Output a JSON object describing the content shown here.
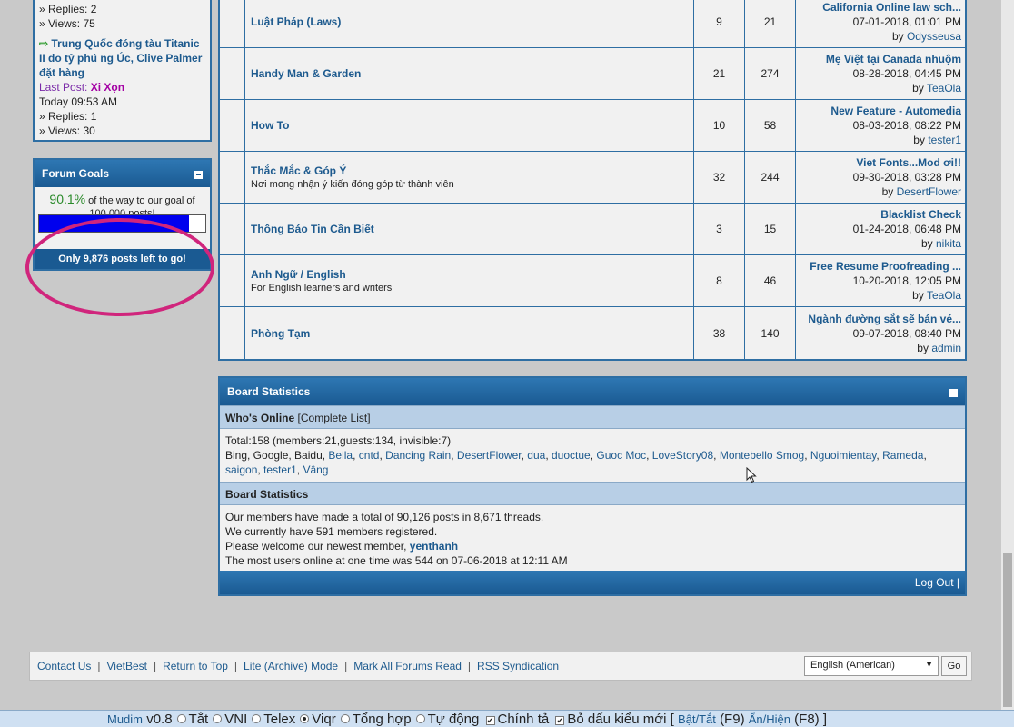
{
  "sidebar": {
    "recent": {
      "prev_replies": "» Replies: 2",
      "prev_views": "» Views: 75",
      "thread_title": "Trung Quốc đóng tàu Titanic II do tỷ phú ng Úc, Clive Palmer đặt hàng",
      "last_post_label": "Last Post:",
      "last_post_user": "Xi Xọn",
      "last_post_time": "Today 09:53 AM",
      "replies": "» Replies: 1",
      "views": "» Views: 30"
    },
    "goals": {
      "title": "Forum Goals",
      "percent_text": "90.1%",
      "goal_text": "of the way to our goal of 100,000 posts!",
      "progress": 0.901,
      "remaining": "Only 9,876 posts left to go!"
    }
  },
  "forums": [
    {
      "name": "Luật Pháp (Laws)",
      "desc": "",
      "threads": "9",
      "posts": "21",
      "last_title": "California Online law sch...",
      "last_date": "07-01-2018,",
      "last_time": "01:01 PM",
      "last_user": "Odysseusa"
    },
    {
      "name": "Handy Man & Garden",
      "desc": "",
      "threads": "21",
      "posts": "274",
      "last_title": "Mẹ Việt tại Canada nhuộm",
      "last_date": "08-28-2018,",
      "last_time": "04:45 PM",
      "last_user": "TeaOla"
    },
    {
      "name": "How To",
      "desc": "",
      "threads": "10",
      "posts": "58",
      "last_title": "New Feature - Automedia",
      "last_date": "08-03-2018,",
      "last_time": "08:22 PM",
      "last_user": "tester1"
    },
    {
      "name": "Thắc Mắc & Góp Ý",
      "desc": "Nơi mong nhận ý kiến đóng góp từ thành viên",
      "threads": "32",
      "posts": "244",
      "last_title": "Viet Fonts...Mod ơi!!",
      "last_date": "09-30-2018,",
      "last_time": "03:28 PM",
      "last_user": "DesertFlower"
    },
    {
      "name": "Thông Báo Tin Cần Biết",
      "desc": "",
      "threads": "3",
      "posts": "15",
      "last_title": "Blacklist Check",
      "last_date": "01-24-2018,",
      "last_time": "06:48 PM",
      "last_user": "nikita"
    },
    {
      "name": "Anh Ngữ / English",
      "desc": "For English learners and writers",
      "threads": "8",
      "posts": "46",
      "last_title": "Free Resume Proofreading ...",
      "last_date": "10-20-2018,",
      "last_time": "12:05 PM",
      "last_user": "TeaOla"
    },
    {
      "name": "Phòng Tạm",
      "desc": "",
      "threads": "38",
      "posts": "140",
      "last_title": "Ngành đường sắt sẽ bán vé...",
      "last_date": "09-07-2018,",
      "last_time": "08:40 PM",
      "last_user": "admin"
    }
  ],
  "by_label": "by",
  "stats": {
    "title": "Board Statistics",
    "online_title": "Who's Online",
    "online_link": "[Complete List]",
    "online_total": "Total:158  (members:21,guests:134, invisible:7)",
    "online_bots": "Bing, Google, Baidu,",
    "online_users": [
      "Bella",
      "cntd",
      "Dancing Rain",
      "DesertFlower",
      "dua",
      "duoctue",
      "Guoc Moc",
      "LoveStory08",
      "Montebello Smog",
      "Nguoimientay",
      "Rameda",
      "saigon",
      "tester1",
      "Vâng"
    ],
    "board_title": "Board Statistics",
    "line1": "Our members have made a total of 90,126 posts in 8,671 threads.",
    "line2": "We currently have 591 members registered.",
    "line3": "Please welcome our newest member,",
    "newest": "yenthanh",
    "line4": "The most users online at one time was 544 on 07-06-2018 at 12:11 AM",
    "logout": "Log Out |"
  },
  "footer": {
    "links": [
      "Contact Us",
      "VietBest",
      "Return to Top",
      "Lite (Archive) Mode",
      "Mark All Forums Read",
      "RSS Syndication"
    ],
    "language": "English (American)",
    "go": "Go"
  },
  "mudim": {
    "name": "Mudim",
    "version": "v0.8",
    "options": [
      "Tắt",
      "VNI",
      "Telex",
      "Viqr",
      "Tổng hợp",
      "Tự động"
    ],
    "selected": "Viqr",
    "checks": [
      "Chính tả",
      "Bỏ dấu kiểu mới"
    ],
    "toggle": "Bật/Tắt",
    "toggle_key": "(F9)",
    "show": "Ẩn/Hiện",
    "show_key": "(F8)"
  }
}
